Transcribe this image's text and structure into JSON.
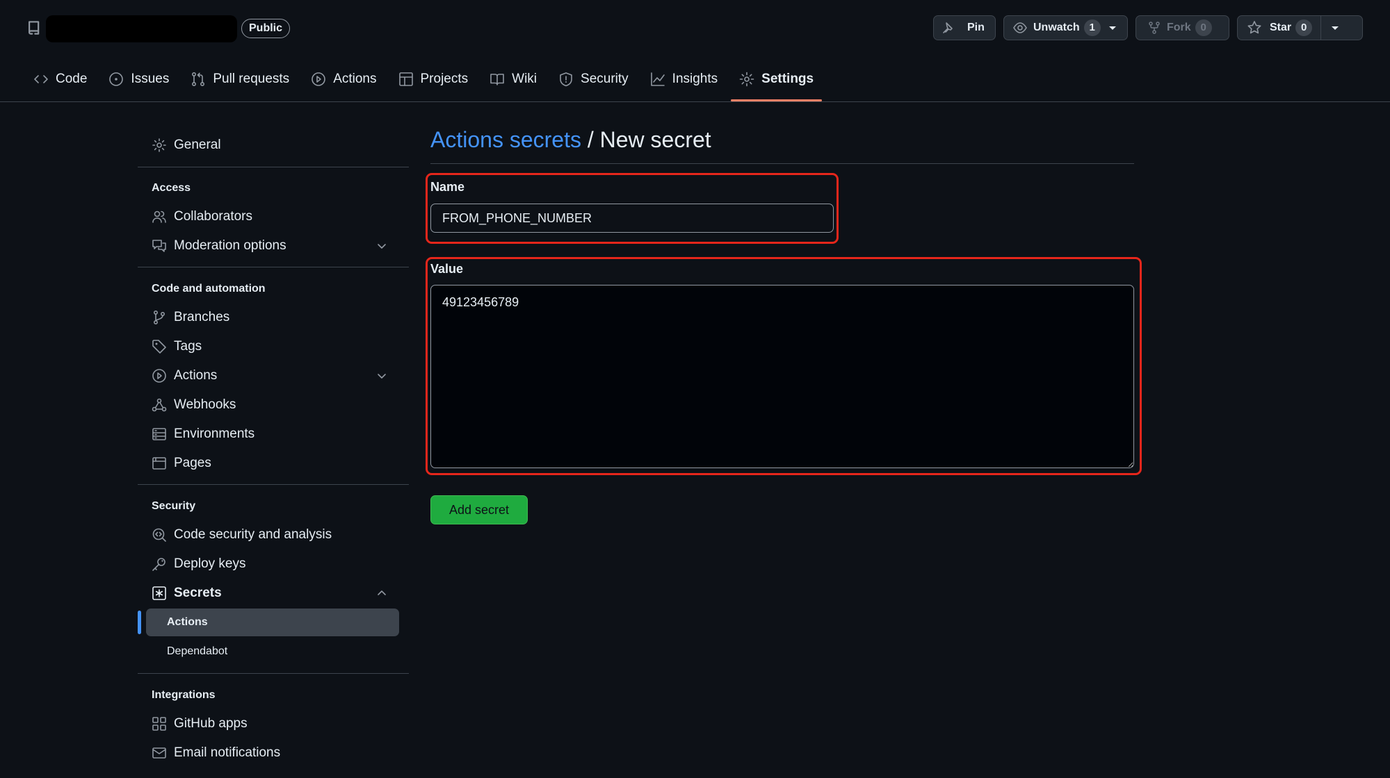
{
  "repo": {
    "visibility_badge": "Public"
  },
  "header_actions": {
    "pin": "Pin",
    "unwatch": "Unwatch",
    "unwatch_count": "1",
    "fork": "Fork",
    "fork_count": "0",
    "star": "Star",
    "star_count": "0"
  },
  "tabs": [
    {
      "label": "Code",
      "icon": "code-icon"
    },
    {
      "label": "Issues",
      "icon": "issue-icon"
    },
    {
      "label": "Pull requests",
      "icon": "pull-request-icon"
    },
    {
      "label": "Actions",
      "icon": "play-icon"
    },
    {
      "label": "Projects",
      "icon": "table-icon"
    },
    {
      "label": "Wiki",
      "icon": "book-icon"
    },
    {
      "label": "Security",
      "icon": "shield-icon"
    },
    {
      "label": "Insights",
      "icon": "graph-icon"
    },
    {
      "label": "Settings",
      "icon": "gear-icon",
      "active": true
    }
  ],
  "sidebar": {
    "general": "General",
    "access_heading": "Access",
    "collaborators": "Collaborators",
    "moderation": "Moderation options",
    "code_heading": "Code and automation",
    "branches": "Branches",
    "tags": "Tags",
    "actions": "Actions",
    "webhooks": "Webhooks",
    "environments": "Environments",
    "pages": "Pages",
    "security_heading": "Security",
    "code_security": "Code security and analysis",
    "deploy_keys": "Deploy keys",
    "secrets": "Secrets",
    "secrets_actions": "Actions",
    "secrets_dependabot": "Dependabot",
    "integrations_heading": "Integrations",
    "github_apps": "GitHub apps",
    "email_notifications": "Email notifications"
  },
  "main": {
    "breadcrumb_link": "Actions secrets",
    "breadcrumb_sep": " / ",
    "breadcrumb_current": "New secret",
    "name_label": "Name",
    "name_value": "FROM_PHONE_NUMBER",
    "value_label": "Value",
    "value_value": "49123456789",
    "submit_label": "Add secret"
  },
  "colors": {
    "background": "#0d1117",
    "link": "#4493f8",
    "highlight": "#e5261b",
    "primary_button": "#1fab3f",
    "tab_underline": "#f78166"
  }
}
